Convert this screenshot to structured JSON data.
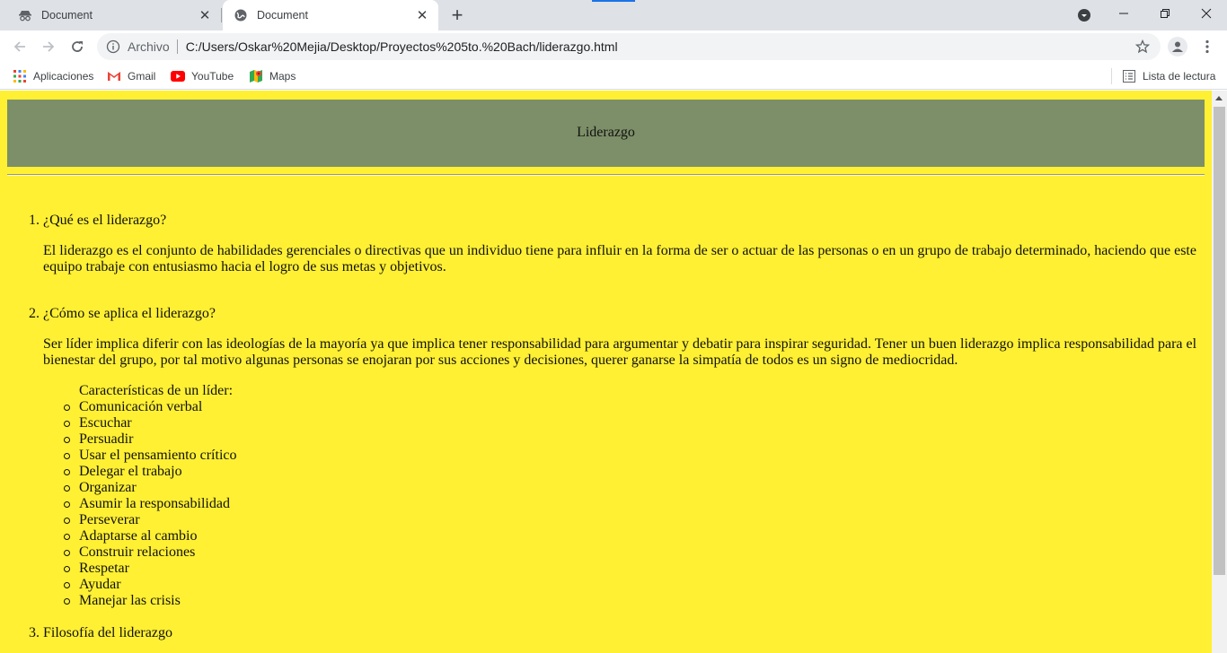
{
  "tabs": [
    {
      "title": "Document",
      "active": false,
      "favicon": "incognito-icon"
    },
    {
      "title": "Document",
      "active": true,
      "favicon": "globe-icon"
    }
  ],
  "toolbar": {
    "scheme_label": "Archivo",
    "url": "C:/Users/Oskar%20Mejia/Desktop/Proyectos%205to.%20Bach/liderazgo.html"
  },
  "bookmarks": {
    "items": [
      {
        "label": "Aplicaciones",
        "icon": "apps-grid-icon"
      },
      {
        "label": "Gmail",
        "icon": "gmail-icon"
      },
      {
        "label": "YouTube",
        "icon": "youtube-icon"
      },
      {
        "label": "Maps",
        "icon": "maps-icon"
      }
    ],
    "reading_list": "Lista de lectura"
  },
  "page": {
    "header_title": "Liderazgo",
    "sections": [
      {
        "number": "1.",
        "title": "¿Qué es el liderazgo?",
        "paragraph": "El liderazgo es el conjunto de habilidades gerenciales o directivas que un individuo tiene para influir en la forma de ser o actuar de las personas o en un grupo de trabajo determinado, haciendo que este equipo trabaje con entusiasmo hacia el logro de sus metas y objetivos."
      },
      {
        "number": "2.",
        "title": "¿Cómo se aplica el liderazgo?",
        "paragraph": "Ser líder implica diferir con las ideologías de la mayoría ya que implica tener responsabilidad para argumentar y debatir para inspirar seguridad. Tener un buen liderazgo implica responsabilidad para el bienestar del grupo, por tal motivo algunas personas se enojaran por sus acciones y decisiones, querer ganarse la simpatía de todos es un signo de mediocridad.",
        "list_heading": "Características de un líder:",
        "list": [
          "Comunicación verbal",
          "Escuchar",
          "Persuadir",
          "Usar el pensamiento crítico",
          "Delegar el trabajo",
          "Organizar",
          "Asumir la responsabilidad",
          "Perseverar",
          "Adaptarse al cambio",
          "Construir relaciones",
          "Respetar",
          "Ayudar",
          "Manejar las crisis"
        ]
      },
      {
        "number": "3.",
        "title": "Filosofía del liderazgo"
      }
    ]
  },
  "colors": {
    "page_background": "#fff033",
    "header_background": "#7d8f68"
  }
}
